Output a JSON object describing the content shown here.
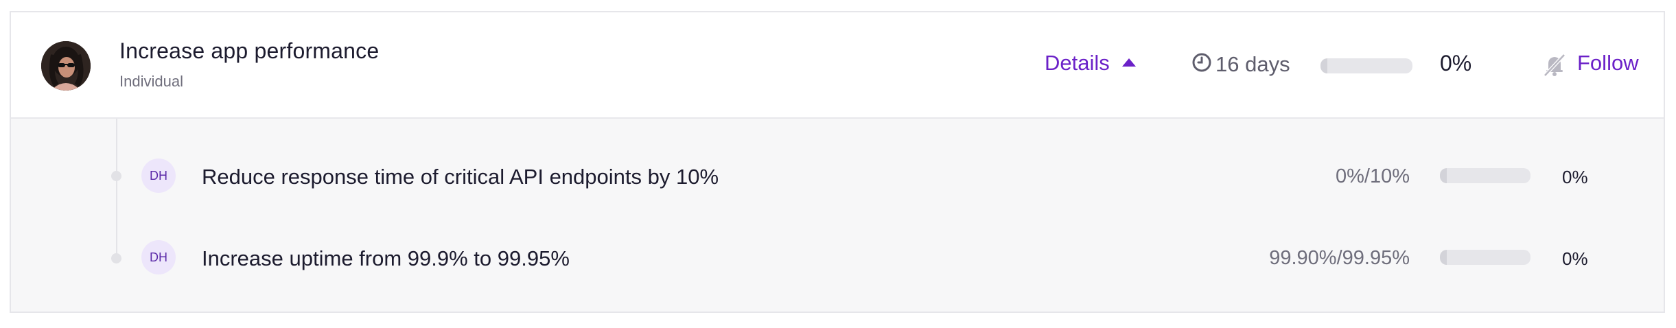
{
  "objective": {
    "title": "Increase app performance",
    "type": "Individual",
    "details_label": "Details",
    "time_left": "16 days",
    "progress_label": "0%",
    "progress_value": 0,
    "follow_label": "Follow"
  },
  "key_results": [
    {
      "initials": "DH",
      "title": "Reduce response time of critical API endpoints by 10%",
      "current_target": "0%/10%",
      "progress_label": "0%",
      "progress_value": 0
    },
    {
      "initials": "DH",
      "title": "Increase uptime from 99.9% to 99.95%",
      "current_target": "99.90%/99.95%",
      "progress_label": "0%",
      "progress_value": 0
    }
  ],
  "colors": {
    "accent": "#6b21c8",
    "text": "#1c1b2e",
    "muted": "#6f6e7c",
    "bar_bg": "#e6e6ea",
    "expanded_bg": "#f7f7f8"
  },
  "icons": {
    "avatar": "user-avatar-photo",
    "details_caret": "caret-up-icon",
    "time": "clock-icon",
    "follow": "bell-muted-icon"
  }
}
